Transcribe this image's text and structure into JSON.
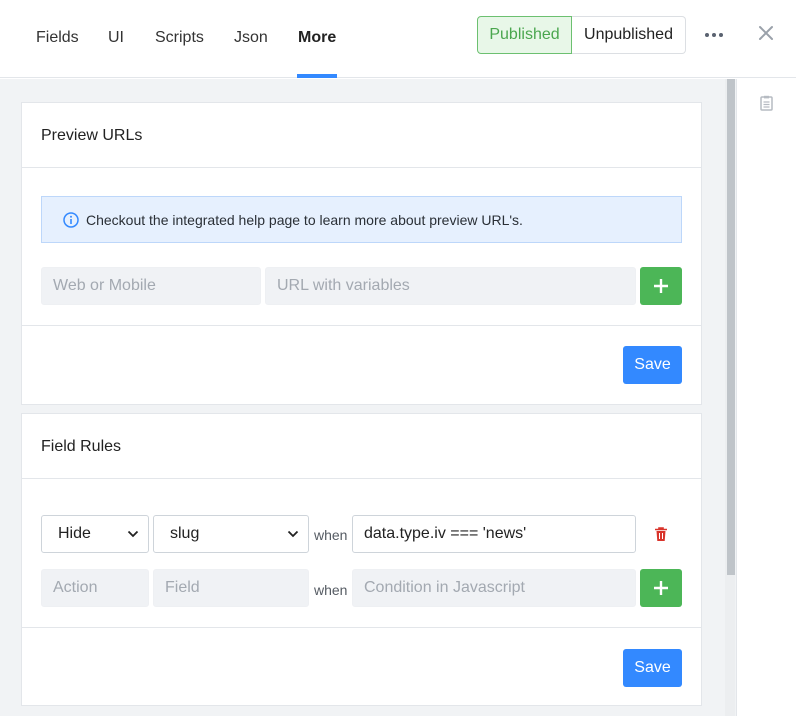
{
  "tabs": [
    {
      "label": "Fields"
    },
    {
      "label": "UI"
    },
    {
      "label": "Scripts"
    },
    {
      "label": "Json"
    },
    {
      "label": "More",
      "active": true
    }
  ],
  "status_toggle": {
    "published": "Published",
    "unpublished": "Unpublished",
    "selected": "Published"
  },
  "icons": {
    "more": "ellipsis-icon",
    "close": "close-icon",
    "panel": "clipboard-icon"
  },
  "colors": {
    "accent": "#3389ff",
    "success": "#4cb657",
    "danger": "#d9342b",
    "info_bg": "#e6f0fe"
  },
  "preview_urls": {
    "title": "Preview URLs",
    "help_text": "Checkout the integrated help page to learn more about preview URL's.",
    "name_placeholder": "Web or Mobile",
    "url_placeholder": "URL with variables",
    "add_icon": "plus-icon",
    "save_label": "Save"
  },
  "field_rules": {
    "title": "Field Rules",
    "rules": [
      {
        "action": "Hide",
        "field": "slug",
        "when": "when",
        "condition": "data.type.iv === 'news'"
      }
    ],
    "new_rule": {
      "action_placeholder": "Action",
      "field_placeholder": "Field",
      "when": "when",
      "condition_placeholder": "Condition in Javascript"
    },
    "save_label": "Save"
  }
}
